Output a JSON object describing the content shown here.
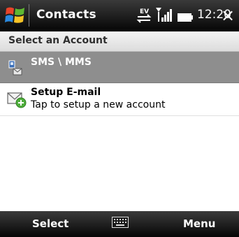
{
  "titlebar": {
    "app_title": "Contacts",
    "clock": "12:20",
    "close_glyph": "×",
    "icons": [
      "windows-start-icon",
      "ev-data-connection-icon",
      "signal-strength-icon",
      "battery-icon"
    ]
  },
  "section": {
    "header": "Select an Account"
  },
  "list": {
    "items": [
      {
        "label": "SMS \\ MMS",
        "icon": "sms-mms-icon",
        "selected": true
      },
      {
        "title": "Setup E-mail",
        "subtitle": "Tap to setup a new account",
        "icon": "setup-email-icon"
      }
    ]
  },
  "softkeys": {
    "left": "Select",
    "center_icon": "keyboard-icon",
    "right": "Menu"
  },
  "colors": {
    "selection": "#8e8e8e",
    "bar_dark": "#050505",
    "header_bg": "#e6e6e6",
    "windows_red": "#e8442a",
    "windows_green": "#5fb832",
    "windows_blue": "#2a8ae0",
    "windows_yellow": "#f6c326"
  }
}
